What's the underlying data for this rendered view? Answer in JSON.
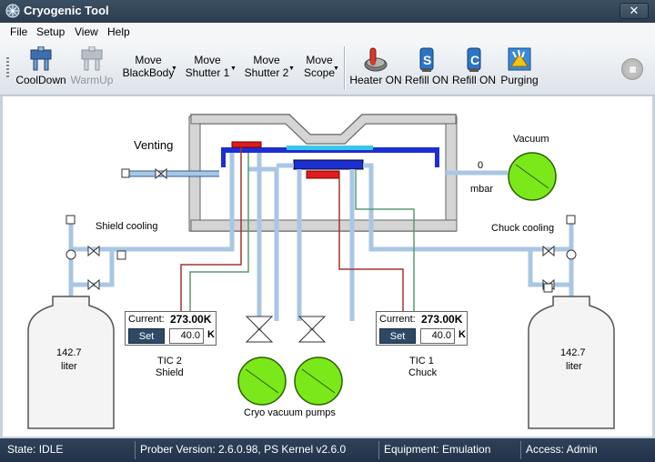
{
  "window": {
    "title": "Cryogenic Tool",
    "close_glyph": "✕"
  },
  "menu": [
    "File",
    "Setup",
    "View",
    "Help"
  ],
  "toolbar": {
    "cooldown": "CoolDown",
    "warmup": "WarmUp",
    "move_blackbody": [
      "Move",
      "BlackBody"
    ],
    "move_shutter1": [
      "Move",
      "Shutter 1"
    ],
    "move_shutter2": [
      "Move",
      "Shutter 2"
    ],
    "move_scope": [
      "Move",
      "Scope"
    ],
    "heater_on": "Heater ON",
    "refill_s": "Refill ON",
    "refill_c": "Refill ON",
    "purging": "Purging",
    "refill_s_letter": "S",
    "refill_c_letter": "C"
  },
  "diagram": {
    "venting": "Venting",
    "vacuum": "Vacuum",
    "vacuum_value": "0",
    "vacuum_unit": "mbar",
    "shield_cooling": "Shield cooling",
    "chuck_cooling": "Chuck cooling",
    "dewar_left": {
      "value": "142.7",
      "unit": "liter"
    },
    "dewar_right": {
      "value": "142.7",
      "unit": "liter"
    },
    "tic2": {
      "current_label": "Current:",
      "current": "273.00K",
      "set_label": "Set",
      "setpoint": "40.0",
      "unit": "K",
      "name": "TIC 2",
      "sub": "Shield"
    },
    "tic1": {
      "current_label": "Current:",
      "current": "273.00K",
      "set_label": "Set",
      "setpoint": "40.0",
      "unit": "K",
      "name": "TIC 1",
      "sub": "Chuck"
    },
    "pumps_label": "Cryo vacuum pumps"
  },
  "status": {
    "state": "State:   IDLE",
    "prober": "Prober Version:    2.6.0.98, PS Kernel v2.6.0",
    "equipment": "Equipment:     Emulation",
    "access": "Access:   Admin"
  },
  "colors": {
    "pipe": "#a9c7e4",
    "pump": "#7be81a",
    "chuck_blue": "#1d2fd0",
    "heater_red": "#e01b1b"
  }
}
